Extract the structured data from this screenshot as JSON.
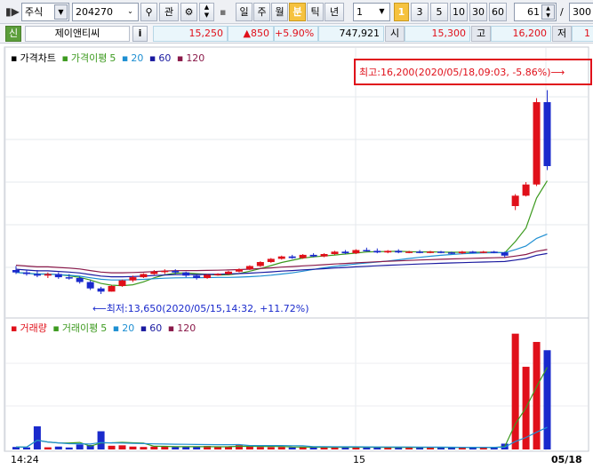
{
  "toolbar": {
    "market": "주식",
    "code": "204270",
    "btn_kwan": "관",
    "period_buttons": [
      "일",
      "주",
      "월",
      "분",
      "틱",
      "년"
    ],
    "active_period": "분",
    "interval_value": "1",
    "interval_buttons": [
      "1",
      "3",
      "5",
      "10",
      "30",
      "60"
    ],
    "active_interval": "1",
    "count_value": "61",
    "slash": "/",
    "total_value": "300"
  },
  "quote": {
    "badge": "신",
    "name": "제이앤티씨",
    "info_btn": "i",
    "price": "15,250",
    "change": "▲850",
    "change_pct": "+5.90%",
    "volume": "747,921",
    "open_label": "시",
    "open": "15,300",
    "high_label": "고",
    "high": "16,200",
    "low_label": "저",
    "low": "1"
  },
  "price_legend": {
    "title": "가격차트",
    "ma_label": "가격이평",
    "ma": [
      "5",
      "20",
      "60",
      "120"
    ]
  },
  "volume_legend": {
    "title": "거래량",
    "ma_label": "거래이평",
    "ma": [
      "5",
      "20",
      "60",
      "120"
    ]
  },
  "colors": {
    "up": "#e0101a",
    "down": "#1a2acc",
    "ma5": "#3c9a1e",
    "ma20": "#1e8fd2",
    "ma60": "#1a1aa0",
    "ma120": "#8a1a4a"
  },
  "annotations": {
    "high": "최고:16,200(2020/05/18,09:03, -5.86%)⟶",
    "low": "⟵최저:13,650(2020/05/15,14:32, +11.72%)"
  },
  "x_labels": [
    "14:24",
    "15",
    "05/18"
  ],
  "chart_data": {
    "type": "candlestick",
    "ohlc": [
      [
        13950,
        14000,
        13900,
        13920
      ],
      [
        13920,
        13950,
        13880,
        13900
      ],
      [
        13900,
        13950,
        13860,
        13880
      ],
      [
        13880,
        13920,
        13850,
        13900
      ],
      [
        13900,
        13920,
        13840,
        13860
      ],
      [
        13860,
        13900,
        13830,
        13850
      ],
      [
        13850,
        13870,
        13780,
        13800
      ],
      [
        13800,
        13820,
        13700,
        13720
      ],
      [
        13720,
        13740,
        13650,
        13680
      ],
      [
        13680,
        13760,
        13680,
        13750
      ],
      [
        13750,
        13830,
        13740,
        13820
      ],
      [
        13820,
        13880,
        13800,
        13860
      ],
      [
        13860,
        13910,
        13850,
        13900
      ],
      [
        13900,
        13950,
        13890,
        13930
      ],
      [
        13930,
        13960,
        13900,
        13940
      ],
      [
        13940,
        13960,
        13900,
        13920
      ],
      [
        13920,
        13930,
        13860,
        13880
      ],
      [
        13880,
        13890,
        13830,
        13850
      ],
      [
        13850,
        13900,
        13840,
        13890
      ],
      [
        13890,
        13910,
        13880,
        13900
      ],
      [
        13900,
        13940,
        13890,
        13930
      ],
      [
        13930,
        13970,
        13920,
        13960
      ],
      [
        13960,
        14010,
        13950,
        14000
      ],
      [
        14000,
        14060,
        13990,
        14050
      ],
      [
        14050,
        14100,
        14040,
        14090
      ],
      [
        14090,
        14130,
        14080,
        14120
      ],
      [
        14120,
        14140,
        14090,
        14100
      ],
      [
        14100,
        14150,
        14090,
        14140
      ],
      [
        14140,
        14160,
        14110,
        14120
      ],
      [
        14120,
        14160,
        14110,
        14150
      ],
      [
        14150,
        14190,
        14140,
        14180
      ],
      [
        14180,
        14200,
        14150,
        14160
      ],
      [
        14160,
        14210,
        14150,
        14200
      ],
      [
        14200,
        14230,
        14180,
        14190
      ],
      [
        14190,
        14220,
        14160,
        14170
      ],
      [
        14170,
        14200,
        14160,
        14190
      ],
      [
        14190,
        14210,
        14160,
        14170
      ],
      [
        14170,
        14190,
        14160,
        14180
      ],
      [
        14180,
        14200,
        14160,
        14170
      ],
      [
        14170,
        14190,
        14160,
        14180
      ],
      [
        14180,
        14190,
        14160,
        14170
      ],
      [
        14170,
        14180,
        14150,
        14160
      ],
      [
        14160,
        14190,
        14150,
        14180
      ],
      [
        14180,
        14190,
        14160,
        14170
      ],
      [
        14170,
        14190,
        14160,
        14180
      ],
      [
        14180,
        14190,
        14160,
        14170
      ],
      [
        14170,
        14180,
        14110,
        14130
      ],
      [
        14750,
        14900,
        14700,
        14880
      ],
      [
        14880,
        15050,
        14870,
        15020
      ],
      [
        15020,
        16100,
        15000,
        16050
      ],
      [
        16050,
        16200,
        15200,
        15250
      ]
    ],
    "volume": [
      3000,
      2500,
      28000,
      2600,
      3500,
      2400,
      6000,
      5500,
      22000,
      4500,
      5000,
      3500,
      3000,
      3500,
      4000,
      2800,
      3200,
      3000,
      4200,
      3000,
      3500,
      5200,
      3500,
      3000,
      2800,
      3000,
      2500,
      3000,
      2600,
      2400,
      2800,
      2500,
      3000,
      2600,
      2400,
      2300,
      2500,
      2400,
      2600,
      2300,
      2500,
      2400,
      2600,
      2400,
      2500,
      2300,
      7000,
      140000,
      100000,
      130000,
      120000
    ],
    "ylim_price": [
      13450,
      16450
    ],
    "ylim_volume": [
      0,
      145000
    ]
  }
}
